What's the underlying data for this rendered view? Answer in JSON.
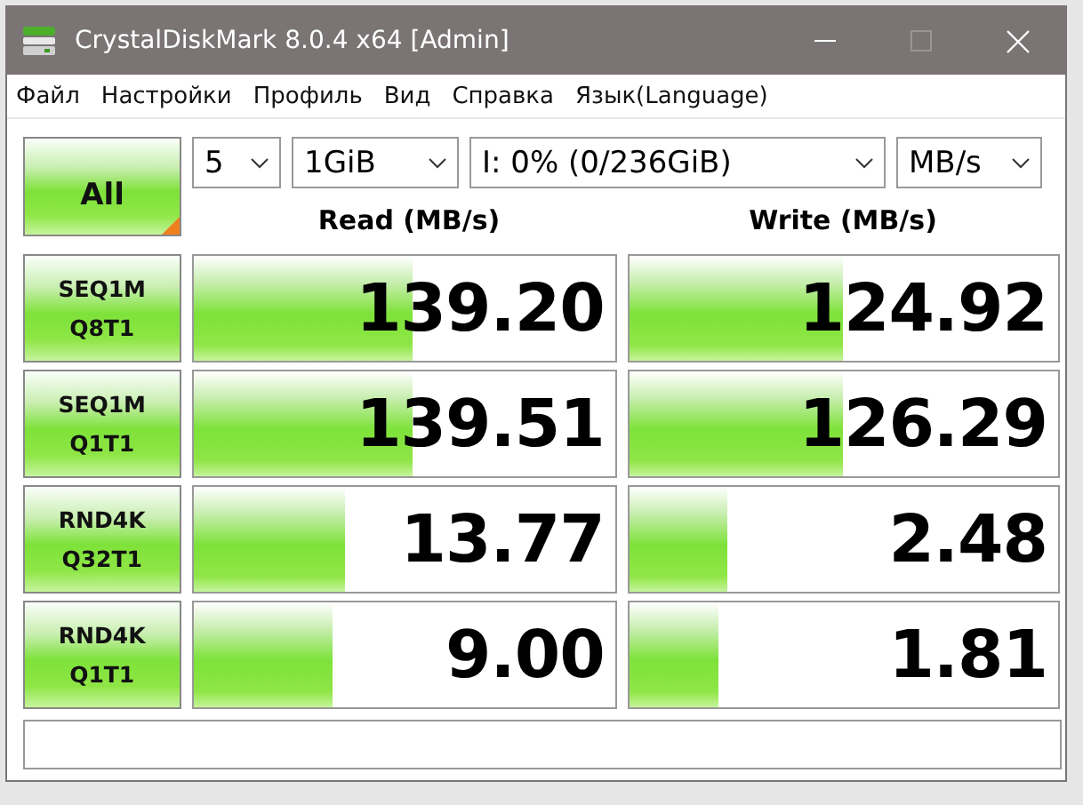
{
  "window": {
    "title": "CrystalDiskMark 8.0.4 x64 [Admin]"
  },
  "menu": [
    "Файл",
    "Настройки",
    "Профиль",
    "Вид",
    "Справка",
    "Язык(Language)"
  ],
  "toolbar": {
    "all_button": "All",
    "count": "5",
    "size": "1GiB",
    "drive": "I: 0% (0/236GiB)",
    "unit": "MB/s"
  },
  "headers": {
    "read": "Read (MB/s)",
    "write": "Write (MB/s)"
  },
  "tests": [
    {
      "line1": "SEQ1M",
      "line2": "Q8T1",
      "read": {
        "value": "139.20",
        "level": 0.52
      },
      "write": {
        "value": "124.92",
        "level": 0.5
      }
    },
    {
      "line1": "SEQ1M",
      "line2": "Q1T1",
      "read": {
        "value": "139.51",
        "level": 0.52
      },
      "write": {
        "value": "126.29",
        "level": 0.5
      }
    },
    {
      "line1": "RND4K",
      "line2": "Q32T1",
      "read": {
        "value": "13.77",
        "level": 0.36
      },
      "write": {
        "value": "2.48",
        "level": 0.23
      }
    },
    {
      "line1": "RND4K",
      "line2": "Q1T1",
      "read": {
        "value": "9.00",
        "level": 0.33
      },
      "write": {
        "value": "1.81",
        "level": 0.21
      }
    }
  ]
}
